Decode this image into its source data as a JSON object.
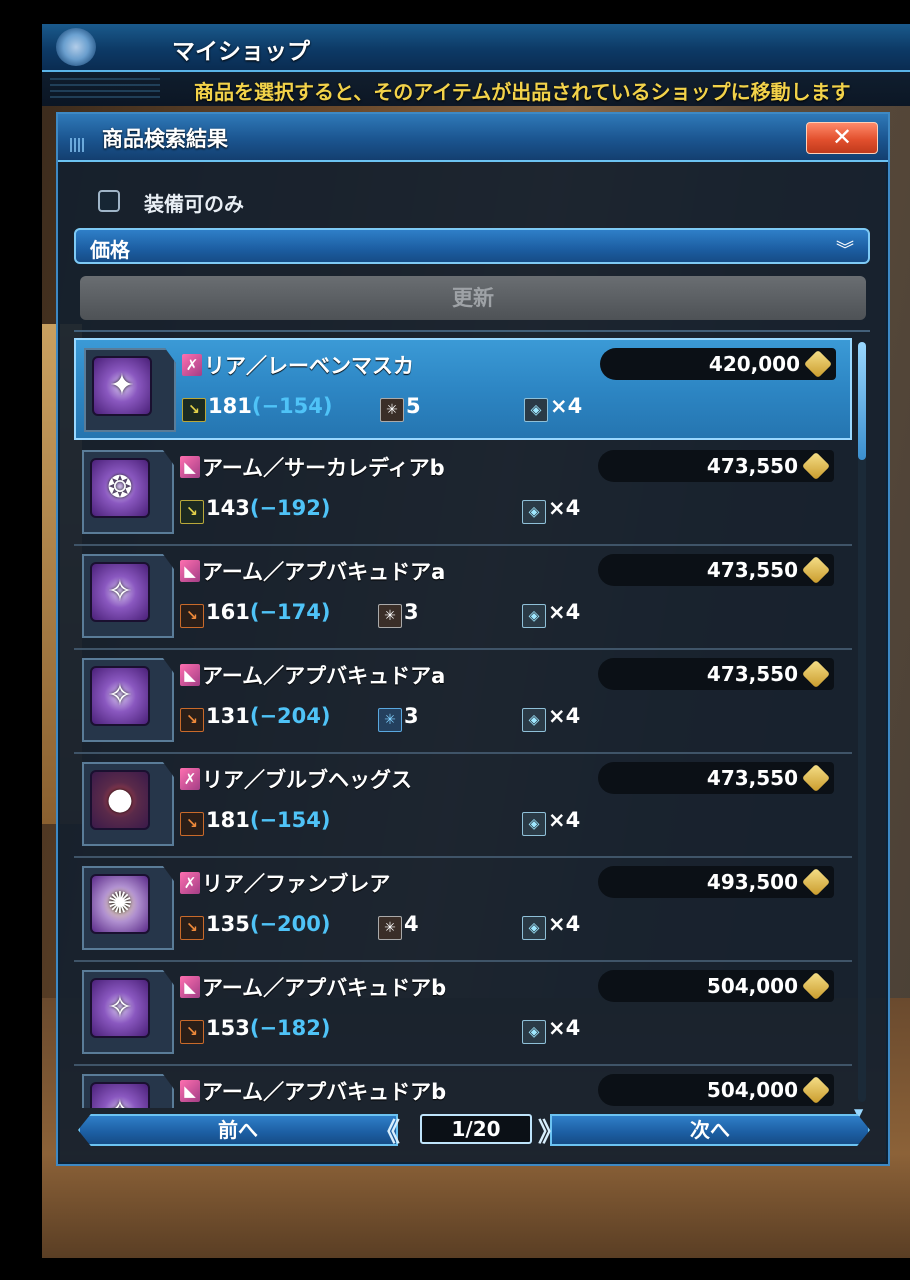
{
  "topbar": {
    "title": "マイショップ"
  },
  "notice": "商品を選択すると、そのアイテムが出品されているショップに移動します",
  "panel": {
    "title": "商品検索結果",
    "close_label": "✕",
    "checkbox_label": "装備可のみ",
    "sort_value": "価格",
    "update_label": "更新"
  },
  "items": [
    {
      "category": "リア",
      "name": "リア／レーベンマスカ",
      "price": "420,000",
      "req": "181",
      "diff": "(−154)",
      "slot": "5",
      "set": "×4",
      "selected": true
    },
    {
      "category": "アーム",
      "name": "アーム／サーカレディアb",
      "price": "473,550",
      "req": "143",
      "diff": "(−192)",
      "slot": "",
      "set": "×4",
      "selected": false
    },
    {
      "category": "アーム",
      "name": "アーム／アプバキュドアa",
      "price": "473,550",
      "req": "161",
      "diff": "(−174)",
      "slot": "3",
      "set": "×4",
      "selected": false
    },
    {
      "category": "アーム",
      "name": "アーム／アプバキュドアa",
      "price": "473,550",
      "req": "131",
      "diff": "(−204)",
      "slot": "3",
      "set": "×4",
      "selected": false
    },
    {
      "category": "リア",
      "name": "リア／ブルブヘッグス",
      "price": "473,550",
      "req": "181",
      "diff": "(−154)",
      "slot": "",
      "set": "×4",
      "selected": false
    },
    {
      "category": "リア",
      "name": "リア／ファンブレア",
      "price": "493,500",
      "req": "135",
      "diff": "(−200)",
      "slot": "4",
      "set": "×4",
      "selected": false
    },
    {
      "category": "アーム",
      "name": "アーム／アプバキュドアb",
      "price": "504,000",
      "req": "153",
      "diff": "(−182)",
      "slot": "",
      "set": "×4",
      "selected": false
    },
    {
      "category": "アーム",
      "name": "アーム／アプバキュドアb",
      "price": "504,000",
      "req": "",
      "diff": "",
      "slot": "",
      "set": "",
      "selected": false
    }
  ],
  "pager": {
    "prev_label": "前へ",
    "next_label": "次へ",
    "page": "1/20"
  }
}
